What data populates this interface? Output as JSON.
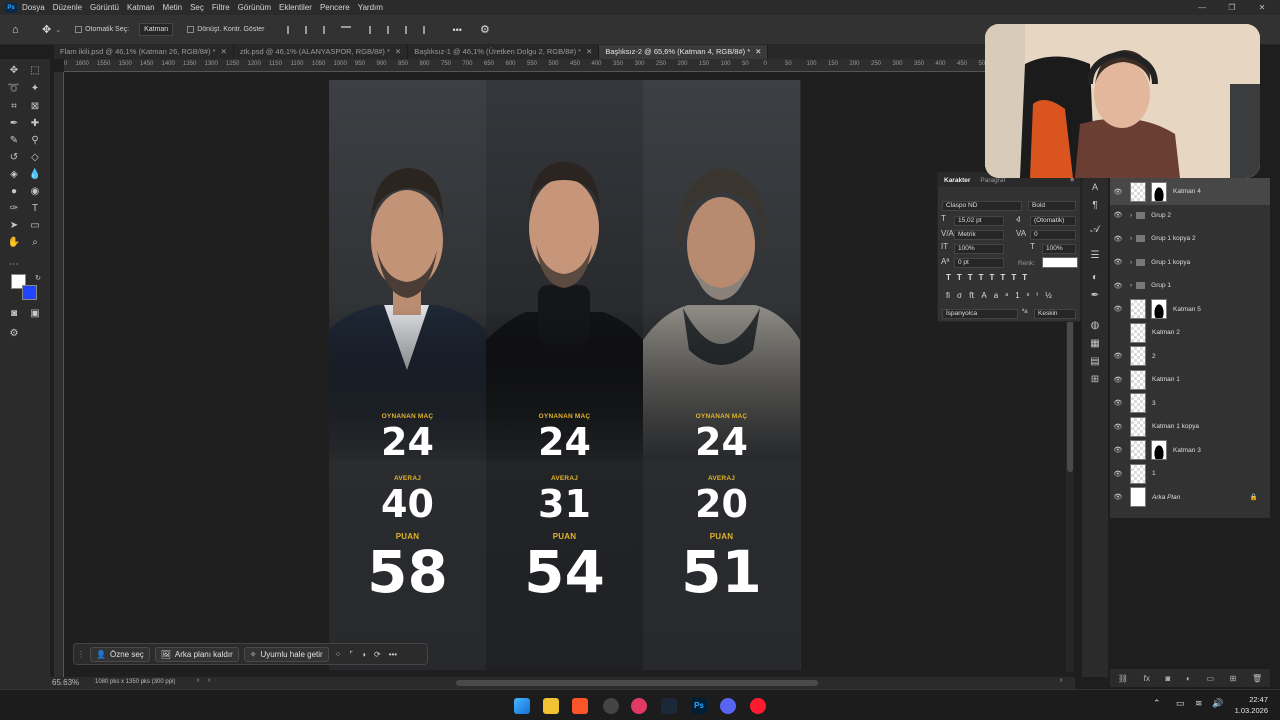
{
  "menubar": {
    "logo": "Ps",
    "items": [
      "Dosya",
      "Düzenle",
      "Görüntü",
      "Katman",
      "Metin",
      "Seç",
      "Filtre",
      "Görünüm",
      "Eklentiler",
      "Pencere",
      "Yardım"
    ]
  },
  "options": {
    "auto_select_label": "Otomatik Seç:",
    "auto_select_value": "Katman",
    "transform_label": "Dönüşt. Kontr. Göster",
    "more": "•••"
  },
  "tabs": [
    {
      "label": "Flam ikili.psd @ 46,1% (Katman 26, RGB/8#) *",
      "active": false
    },
    {
      "label": "ztk.psd @ 46,1% (ALANYASPOR, RGB/8#) *",
      "active": false
    },
    {
      "label": "Başlıksız-1 @ 46,1% (Üretken Dolgu 2, RGB/8#) *",
      "active": false
    },
    {
      "label": "Başlıksız-2 @ 65,6% (Katman 4, RGB/8#) *",
      "active": true
    }
  ],
  "ruler_ticks": [
    "1650",
    "1600",
    "1550",
    "1500",
    "1450",
    "1400",
    "1350",
    "1300",
    "1250",
    "1200",
    "1150",
    "1100",
    "1050",
    "1000",
    "950",
    "900",
    "850",
    "800",
    "750",
    "700",
    "650",
    "600",
    "550",
    "500",
    "450",
    "400",
    "350",
    "300",
    "250",
    "200",
    "150",
    "100",
    "50",
    "0",
    "50",
    "100",
    "150",
    "200",
    "250",
    "300",
    "350",
    "400",
    "450",
    "500",
    "550",
    "600",
    "650",
    "700",
    "750",
    "800",
    "850",
    "900",
    "950",
    "1000",
    "1050",
    "1100",
    "1150",
    "1200",
    "1250",
    "1300",
    "1350",
    "1400",
    "1450",
    "1500",
    "1550",
    "1600",
    "1650",
    "1700",
    "1750",
    "1800",
    "1850",
    "1900",
    "1950",
    "2000",
    "2050",
    "2100",
    "2150",
    "2200",
    "2250",
    "2300",
    "2350",
    "2400",
    "2450",
    "2500",
    "2550",
    "2600",
    "2650"
  ],
  "canvas": {
    "players": [
      {
        "games_label": "OYNANAN MAÇ",
        "games": "24",
        "avg_label": "AVERAJ",
        "avg": "40",
        "points_label": "PUAN",
        "points": "58"
      },
      {
        "games_label": "OYNANAN MAÇ",
        "games": "24",
        "avg_label": "AVERAJ",
        "avg": "31",
        "points_label": "PUAN",
        "points": "54"
      },
      {
        "games_label": "OYNANAN MAÇ",
        "games": "24",
        "avg_label": "AVERAJ",
        "avg": "20",
        "points_label": "PUAN",
        "points": "51"
      }
    ]
  },
  "contextbar": {
    "select_subject": "Özne seç",
    "remove_bg": "Arka planı kaldır",
    "make_fit": "Uyumlu hale getir",
    "more": "•••"
  },
  "status": {
    "zoom": "65.63%",
    "doc_info": "1080 pks x 1350 pks (300 ppi)"
  },
  "character": {
    "tab_character": "Karakter",
    "tab_paragraph": "Paragraf",
    "font": "Claspo ND",
    "style": "Bold",
    "size": "15,02 pt",
    "leading": "(Otomatik)",
    "kerning": "Metrik",
    "tracking": "0",
    "vscale": "100%",
    "hscale": "100%",
    "baseline": "0 pt",
    "color_label": "Renk:",
    "color": "#ffffff",
    "language": "İspanyolca",
    "antialias": "Keskin"
  },
  "layers": [
    {
      "name": "Katman 4",
      "type": "mask",
      "visible": true
    },
    {
      "name": "Grup 2",
      "type": "group",
      "visible": true
    },
    {
      "name": "Grup 1 kopya 2",
      "type": "group",
      "visible": true
    },
    {
      "name": "Grup 1 kopya",
      "type": "group",
      "visible": true
    },
    {
      "name": "Grup 1",
      "type": "group",
      "visible": true
    },
    {
      "name": "Katman 5",
      "type": "mask",
      "visible": true
    },
    {
      "name": "Katman 2",
      "type": "image",
      "visible": false
    },
    {
      "name": "2",
      "type": "image",
      "visible": true
    },
    {
      "name": "Katman 1",
      "type": "image",
      "visible": true
    },
    {
      "name": "3",
      "type": "image",
      "visible": true
    },
    {
      "name": "Katman 1 kopya",
      "type": "image",
      "visible": true
    },
    {
      "name": "Katman 3",
      "type": "mask",
      "visible": true
    },
    {
      "name": "1",
      "type": "image",
      "visible": true
    },
    {
      "name": "Arka Plan",
      "type": "background",
      "visible": true
    }
  ],
  "clock": {
    "time": "22:47",
    "date": "1.03.2026"
  }
}
